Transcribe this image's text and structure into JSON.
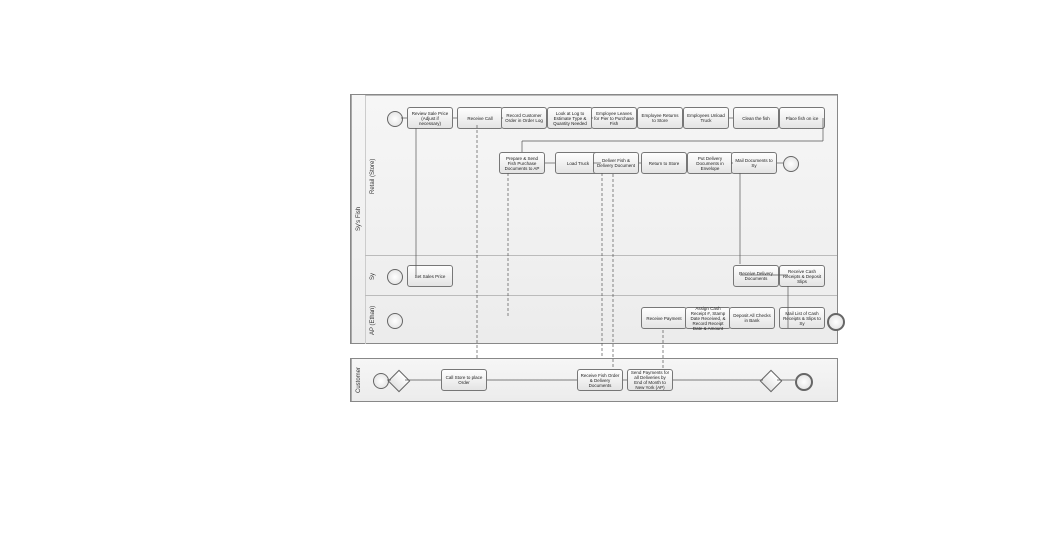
{
  "pools": {
    "sys": {
      "label": "Sy's Fish",
      "lanes": {
        "retail": {
          "label": "Retail (Store)",
          "tasks": {
            "reviewPrice": "Review Sale Price (Adjust if necessary)",
            "receiveCall": "Receive Call",
            "recordOrder": "Record Customer Order in Order Log",
            "lookAtLog": "Look at Log to Estimate Type & Quantity Needed",
            "employeeLeaves": "Employee Leaves for Pier to Purchase Fish",
            "employeeReturns": "Employee Returns to Store",
            "employeesUnload": "Employees Unload Truck",
            "cleanFish": "Clean the fish",
            "placeOnIce": "Place fish on ice",
            "prepareDocs": "Prepare & Send Fish Purchase Documents to AP",
            "loadTruck": "Load Truck",
            "deliverFish": "Deliver Fish & Delivery Document",
            "returnToStore": "Return to Store",
            "putDeliveryDocs": "Put Delivery Documents in Envelope",
            "mailDocsToSy": "Mail Documents to Sy"
          }
        },
        "sy": {
          "label": "Sy",
          "tasks": {
            "setPrice": "Set Sales Price",
            "receiveDelivery": "Receive Delivery Documents",
            "receiveCash": "Receive Cash Receipts & Deposit Slips"
          }
        },
        "ap": {
          "label": "AP (Ethan)",
          "tasks": {
            "receivePayment": "Receive Payment",
            "assignReceipt": "Assign Cash Receipt #, Stamp Date Received, & Record Receipt Date & Amount",
            "deposit": "Deposit All Checks in Bank",
            "mailList": "Mail List of Cash Receipts & Slips to Sy"
          }
        }
      }
    },
    "customer": {
      "label": "Customer",
      "tasks": {
        "callStore": "Call Store to place Order",
        "receiveFishOrder": "Receive Fish Order & Delivery Documents",
        "sendPayments": "Send Payments for all Deliveries by End of Month to New York (AP)"
      }
    }
  }
}
